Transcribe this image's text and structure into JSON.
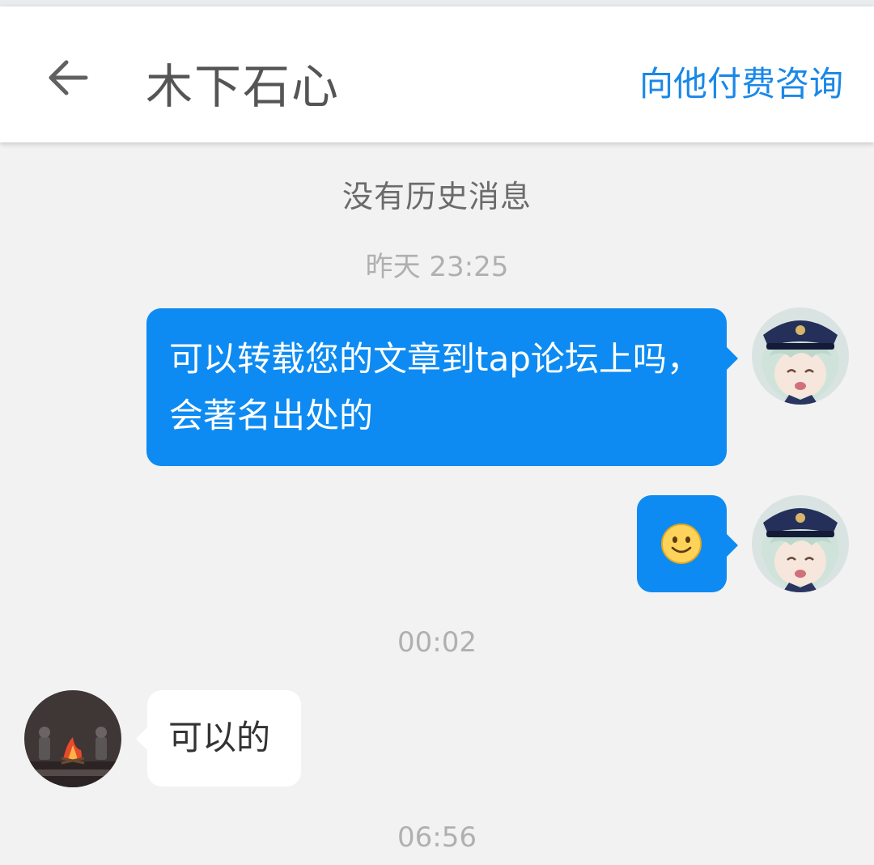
{
  "header": {
    "back_icon": "back-arrow-icon",
    "title": "木下石心",
    "action_label": "向他付费咨询",
    "accent_color": "#1a88e8"
  },
  "chat": {
    "no_history": "没有历史消息",
    "outgoing_bubble_color": "#0d8bf2",
    "items": [
      {
        "type": "time",
        "text": "昨天 23:25"
      },
      {
        "type": "message",
        "direction": "outgoing",
        "text": "可以转载您的文章到tap论坛上吗，会著名出处的",
        "avatar": "user-avatar-anime-girl"
      },
      {
        "type": "message",
        "direction": "outgoing",
        "emoji": "smile-emoji-icon",
        "avatar": "user-avatar-anime-girl"
      },
      {
        "type": "time",
        "text": "00:02"
      },
      {
        "type": "message",
        "direction": "incoming",
        "text": "可以的",
        "avatar": "contact-avatar-campfire"
      },
      {
        "type": "time",
        "text": "06:56"
      }
    ]
  }
}
